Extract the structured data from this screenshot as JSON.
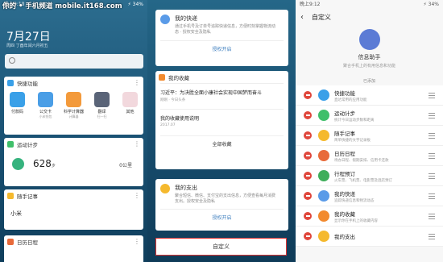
{
  "watermark": "你的 • 手机频道 mobile.it168.com",
  "panel1": {
    "status_time": "晚上9:10",
    "status_right": "⚡ 34%",
    "date": "7月27日",
    "lunar": "周四 丁酉年闰六月初五",
    "quick": {
      "title": "快捷功能",
      "tools": [
        {
          "label": "付款码",
          "sub": "",
          "color": "#3aa0e8"
        },
        {
          "label": "公交卡",
          "sub": "小米钱包",
          "color": "#4a9ee6"
        },
        {
          "label": "科学计算器",
          "sub": "计算器",
          "color": "#f39a3b"
        },
        {
          "label": "翻译",
          "sub": "扫一扫",
          "color": "#5a6478"
        },
        {
          "label": "其他",
          "sub": "",
          "color": "#f2d8dd"
        }
      ]
    },
    "steps": {
      "title": "运动计步",
      "count": "628",
      "unit": "步",
      "km": "0公里"
    },
    "notes": {
      "title": "随手记事",
      "content": "小米"
    },
    "calendar": {
      "title": "日历日程"
    }
  },
  "panel2": {
    "express": {
      "title": "我的快递",
      "desc": "通过手机号及订单号追踪快递信息，方便时刻掌握物流动态 · 授权安全及隐私",
      "btn": "授权开启"
    },
    "favorites": {
      "title": "我的收藏",
      "items": [
        {
          "title": "习近平：为决胜全面小康社会实现中国梦而奋斗",
          "meta": "刚刚 · 今日头条"
        },
        {
          "title": "我的收藏使用说明",
          "meta": "2017.07"
        }
      ],
      "all": "全部收藏"
    },
    "expense": {
      "title": "我的支出",
      "desc": "聚合短信、微信、支付宝的支出信息，方便查看每月消费支出。授权安全及隐私",
      "btn": "授权开启"
    },
    "customize": "自定义"
  },
  "panel3": {
    "status_time": "晚上9:12",
    "status_right": "⚡ 34%",
    "title": "自定义",
    "info_title": "信息助手",
    "info_desc": "聚合手机上的有用信息和功能",
    "added_label": "已添加",
    "rows": [
      {
        "title": "快捷功能",
        "desc": "直达常用的应用功能",
        "color": "#3aa0e8"
      },
      {
        "title": "运动计步",
        "desc": "统计今日运动步数和距离",
        "color": "#3fbf6a"
      },
      {
        "title": "随手记事",
        "desc": "简单快捷的文字记录板",
        "color": "#f5b92e"
      },
      {
        "title": "日历日程",
        "desc": "待办日程、假期安排、信用卡还款",
        "color": "#e86a3a"
      },
      {
        "title": "行程预订",
        "desc": "火车票、飞机票、电影票及酒店预订",
        "color": "#3fae5a"
      },
      {
        "title": "我的快递",
        "desc": "追踪快递信息和物流动态",
        "color": "#5a9be8"
      },
      {
        "title": "我的收藏",
        "desc": "显示你在手机上的收藏内容",
        "color": "#f28a2e"
      },
      {
        "title": "我的支出",
        "desc": "",
        "color": "#f5b92e"
      }
    ]
  }
}
